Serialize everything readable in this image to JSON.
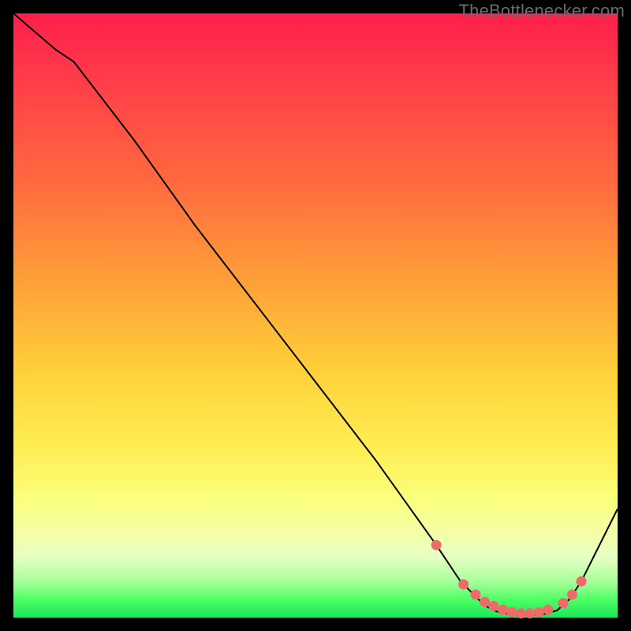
{
  "watermark": "TheBottlenecker.com",
  "chart_data": {
    "type": "line",
    "title": "",
    "xlabel": "",
    "ylabel": "",
    "xlim": [
      0,
      100
    ],
    "ylim": [
      0,
      100
    ],
    "series": [
      {
        "name": "curve",
        "x": [
          0,
          7,
          10,
          20,
          30,
          40,
          50,
          60,
          70,
          74,
          78,
          80,
          82,
          84,
          86,
          88,
          90,
          92,
          94,
          100
        ],
        "y": [
          100,
          94,
          92,
          79,
          65,
          52,
          39,
          26,
          12,
          6,
          2,
          1,
          0.6,
          0.4,
          0.4,
          0.6,
          1.2,
          3,
          6,
          18
        ]
      }
    ],
    "markers": {
      "name": "highlight-points",
      "color": "#ef6b6b",
      "x": [
        70,
        74.5,
        76.5,
        78,
        79.5,
        81,
        82.5,
        84,
        85.5,
        87,
        88.5,
        91,
        92.5,
        94
      ],
      "y": [
        12,
        5.5,
        3.8,
        2.6,
        1.9,
        1.3,
        0.9,
        0.7,
        0.7,
        0.9,
        1.3,
        2.4,
        3.8,
        6
      ]
    }
  },
  "colors": {
    "curve": "#000000",
    "marker": "#ef6b6b",
    "background_black": "#000000"
  }
}
